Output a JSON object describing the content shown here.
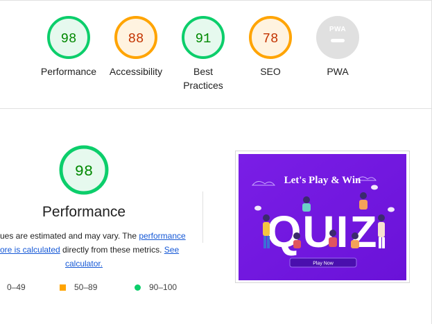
{
  "scores": [
    {
      "name": "Performance",
      "value": "98",
      "level": "good"
    },
    {
      "name": "Accessibility",
      "value": "88",
      "level": "average"
    },
    {
      "name": "Best Practices",
      "value": "91",
      "level": "good"
    },
    {
      "name": "SEO",
      "value": "78",
      "level": "average"
    },
    {
      "name": "PWA",
      "value": "",
      "level": "na",
      "badge": "PWA"
    }
  ],
  "labels": {
    "best_practices_line1": "Best",
    "best_practices_line2": "Practices"
  },
  "main": {
    "score": "98",
    "title": "Performance",
    "desc": {
      "l1_text": "ues are estimated and may vary. The ",
      "l1_link": "performance",
      "l2_link": "ore is calculated",
      "l2_text": " directly from these metrics. ",
      "l2_link2": "See",
      "l3_link": "calculator."
    }
  },
  "legend": {
    "fail": "0–49",
    "average": "50–89",
    "pass": "90–100"
  },
  "screenshot": {
    "headline": "Let's Play & Win",
    "word": "QUIZ",
    "button": "Play Now"
  },
  "colors": {
    "good": "#0cce6b",
    "good_text": "#008800",
    "good_bg": "#e6f9ee",
    "average": "#ffa400",
    "average_text": "#c33300",
    "average_bg": "#fff3e0",
    "na": "#e0e0e0",
    "purple": "#7a1ee6"
  }
}
